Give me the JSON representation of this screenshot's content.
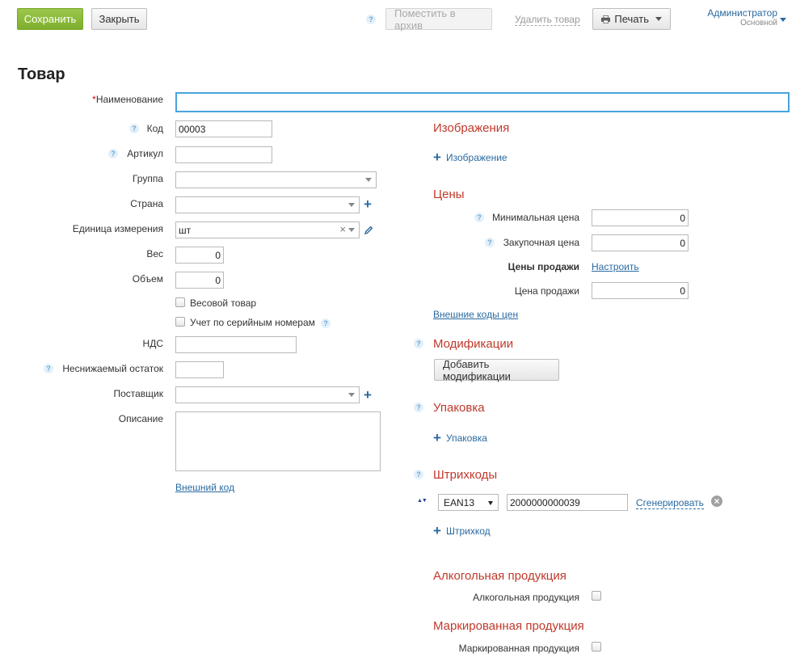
{
  "toolbar": {
    "save_label": "Сохранить",
    "close_label": "Закрыть",
    "archive_label": "Поместить в архив",
    "delete_label": "Удалить товар",
    "print_label": "Печать"
  },
  "user": {
    "name": "Администратор",
    "role": "Основной"
  },
  "page_title": "Товар",
  "left": {
    "name_label": "Наименование",
    "name_value": "",
    "code_label": "Код",
    "code_value": "00003",
    "article_label": "Артикул",
    "article_value": "",
    "group_label": "Группа",
    "group_value": "",
    "country_label": "Страна",
    "country_value": "",
    "unit_label": "Единица измерения",
    "unit_value": "шт",
    "weight_label": "Вес",
    "weight_value": "0",
    "volume_label": "Объем",
    "volume_value": "0",
    "weighted_label": "Весовой товар",
    "serial_label": "Учет по серийным номерам",
    "vat_label": "НДС",
    "vat_value": "",
    "min_balance_label": "Неснижаемый остаток",
    "min_balance_value": "",
    "supplier_label": "Поставщик",
    "supplier_value": "",
    "description_label": "Описание",
    "description_value": "",
    "external_code_link": "Внешний код"
  },
  "right": {
    "images_title": "Изображения",
    "add_image_label": "Изображение",
    "prices_title": "Цены",
    "min_price_label": "Минимальная цена",
    "min_price_value": "0",
    "purchase_price_label": "Закупочная цена",
    "purchase_price_value": "0",
    "sale_prices_label": "Цены продажи",
    "configure_link": "Настроить",
    "sale_price_label": "Цена продажи",
    "sale_price_value": "0",
    "external_price_codes_link": "Внешние коды цен",
    "modifications_title": "Модификации",
    "add_modifications_label": "Добавить модификации",
    "packaging_title": "Упаковка",
    "add_packaging_label": "Упаковка",
    "barcodes_title": "Штрихкоды",
    "barcode_type": "EAN13",
    "barcode_value": "2000000000039",
    "generate_link": "Сгенерировать",
    "add_barcode_label": "Штрихкод",
    "alcohol_title": "Алкогольная продукция",
    "alcohol_label": "Алкогольная продукция",
    "marked_title": "Маркированная продукция",
    "marked_label": "Маркированная продукция"
  },
  "icons": {
    "help": "?",
    "plus": "+",
    "clear": "×",
    "remove_barcode": "×",
    "sort_arrows": "▲▼"
  },
  "colors": {
    "save_button": "#8cbc3a",
    "section_title": "#c0392b",
    "link": "#2a6aa0",
    "focus_border": "#4aa3df"
  }
}
